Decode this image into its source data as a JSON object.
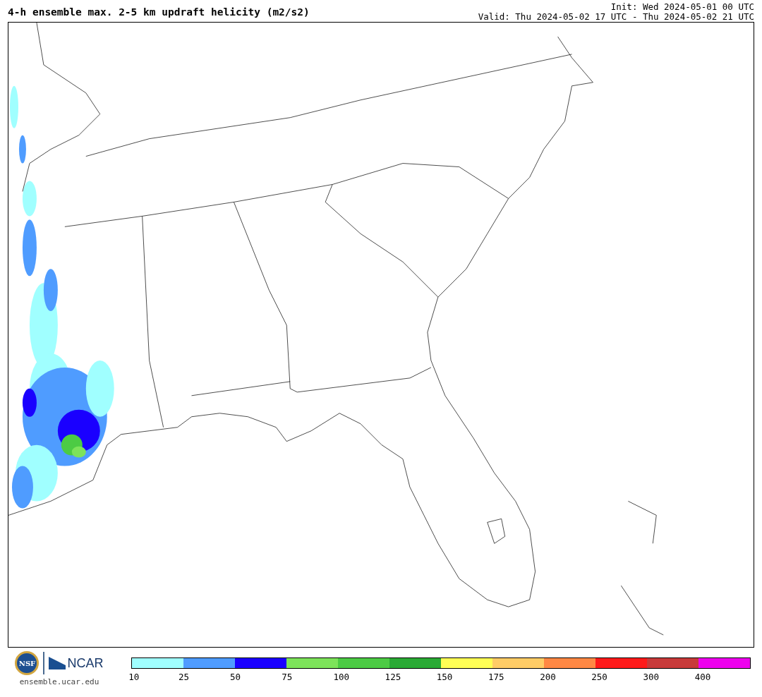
{
  "header": {
    "title": "4-h ensemble max. 2-5 km updraft helicity (m2/s2)",
    "init": "Init: Wed 2024-05-01 00 UTC",
    "valid": "Valid: Thu 2024-05-02 17 UTC - Thu 2024-05-02 21 UTC"
  },
  "footer": {
    "seal_text": "NSF",
    "logo_text": "NCAR",
    "site": "ensemble.ucar.edu"
  },
  "colorbar": [
    {
      "label": "10",
      "color": "#a0ffff"
    },
    {
      "label": "25",
      "color": "#4f9cff"
    },
    {
      "label": "50",
      "color": "#1a00ff"
    },
    {
      "label": "75",
      "color": "#7de35a"
    },
    {
      "label": "100",
      "color": "#4ccb44"
    },
    {
      "label": "125",
      "color": "#2aaa35"
    },
    {
      "label": "150",
      "color": "#ffff55"
    },
    {
      "label": "175",
      "color": "#ffcc66"
    },
    {
      "label": "200",
      "color": "#ff8844"
    },
    {
      "label": "250",
      "color": "#ff1a1a"
    },
    {
      "label": "300",
      "color": "#c83a3a"
    },
    {
      "label": "400",
      "color": "#ee00ee"
    }
  ]
}
